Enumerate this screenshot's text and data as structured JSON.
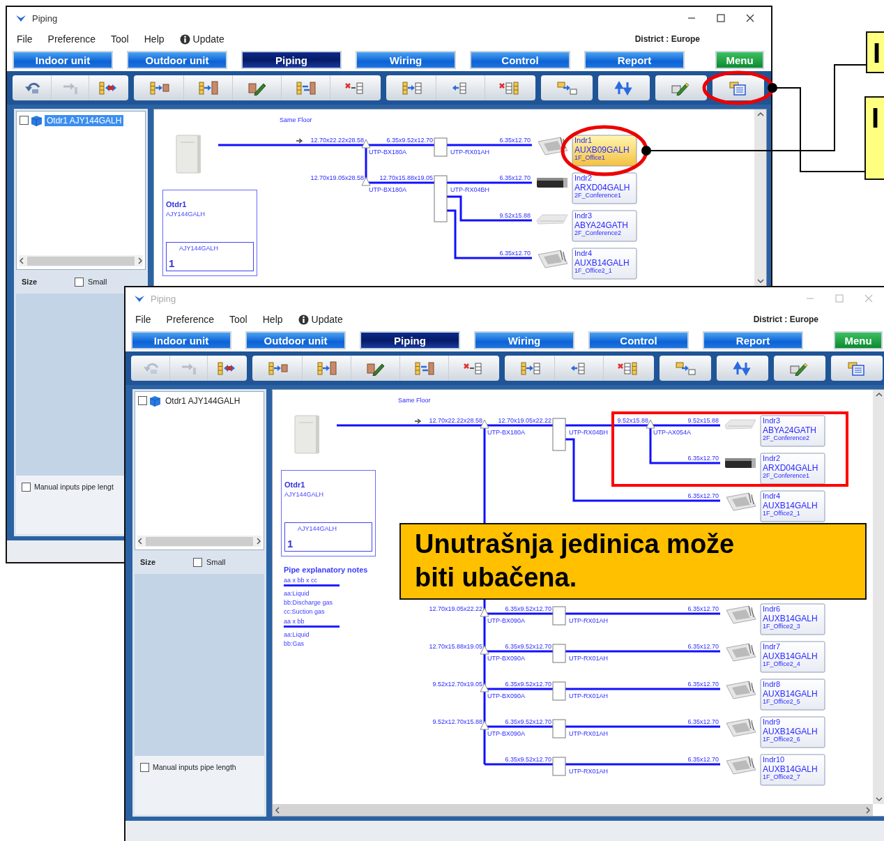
{
  "windows": [
    {
      "title": "Piping",
      "active": true,
      "menu": [
        "File",
        "Preference",
        "Tool",
        "Help"
      ],
      "update": "Update",
      "district": "District : Europe",
      "tabs": [
        {
          "label": "Indoor unit",
          "kind": "tab",
          "selected": false
        },
        {
          "label": "Outdoor unit",
          "kind": "tab",
          "selected": false
        },
        {
          "label": "Piping",
          "kind": "tab",
          "selected": true
        },
        {
          "label": "Wiring",
          "kind": "tab",
          "selected": false
        },
        {
          "label": "Control",
          "kind": "tab",
          "selected": false
        },
        {
          "label": "Report",
          "kind": "tab",
          "selected": false
        },
        {
          "label": "Menu",
          "kind": "menu",
          "selected": false
        }
      ],
      "toolbar": [
        {
          "buttons": [
            {
              "disabled": false,
              "circled": false
            },
            {
              "disabled": true,
              "circled": false
            },
            {
              "disabled": false,
              "circled": false
            }
          ]
        },
        {
          "buttons": [
            {
              "disabled": false,
              "circled": false
            },
            {
              "disabled": false,
              "circled": false
            },
            {
              "disabled": false,
              "circled": false
            },
            {
              "disabled": false,
              "circled": false
            },
            {
              "disabled": false,
              "circled": false
            }
          ]
        },
        {
          "buttons": [
            {
              "disabled": false,
              "circled": false
            },
            {
              "disabled": false,
              "circled": false
            },
            {
              "disabled": false,
              "circled": false
            }
          ]
        },
        {
          "buttons": [
            {
              "disabled": false,
              "circled": false
            }
          ]
        },
        {
          "buttons": [
            {
              "disabled": false,
              "circled": false
            }
          ]
        },
        {
          "buttons": [
            {
              "disabled": false,
              "circled": false
            }
          ]
        },
        {
          "buttons": [
            {
              "disabled": false,
              "circled": true
            }
          ]
        }
      ],
      "tree": [
        {
          "label": "Otdr1 AJY144GALH",
          "checked": false,
          "selected": true
        }
      ],
      "size_label": "Size",
      "small": {
        "label": "Small",
        "checked": false
      },
      "manual": {
        "label": "Manual inputs pipe lengt",
        "checked": false
      },
      "diagram": {
        "floor": "Same Floor",
        "outdoor": {
          "name": "Otdr1",
          "model": "AJY144GALH",
          "sub_model": "AJY144GALH",
          "count": "1"
        },
        "groups": [
          {
            "kind": "branch",
            "trunk": "12.70x22.22x28.58",
            "kit": "UTP-BX180A",
            "segment": "6.35x9.52x12.70",
            "header": "UTP-RX01AH",
            "outlets": [
              {
                "kind": "cassette",
                "pipe": "6.35x12.70",
                "name": "Indr1",
                "model": "AUXB09GALH",
                "room": "1F_Office1",
                "selected": true,
                "circled": true
              }
            ]
          },
          {
            "kind": "branch",
            "trunk": "12.70x19.05x28.58",
            "kit": "UTP-BX180A",
            "segment": "12.70x15.88x19.05",
            "header": "UTP-RX04BH",
            "outlets": [
              {
                "kind": "duct",
                "pipe": "6.35x12.70",
                "name": "Indr2",
                "model": "ARXD04GALH",
                "room": "2F_Conference1",
                "selected": false,
                "circled": false
              },
              {
                "kind": "ceiling",
                "pipe": "9.52x15.88",
                "name": "Indr3",
                "model": "ABYA24GATH",
                "room": "2F_Conference2",
                "selected": false,
                "circled": false
              },
              {
                "kind": "cassette",
                "pipe": "6.35x12.70",
                "name": "Indr4",
                "model": "AUXB14GALH",
                "room": "1F_Office2_1",
                "selected": false,
                "circled": false
              }
            ]
          }
        ]
      }
    },
    {
      "title": "Piping",
      "active": false,
      "menu": [
        "File",
        "Preference",
        "Tool",
        "Help"
      ],
      "update": "Update",
      "district": "District : Europe",
      "tabs": [
        {
          "label": "Indoor unit",
          "kind": "tab",
          "selected": false
        },
        {
          "label": "Outdoor unit",
          "kind": "tab",
          "selected": false
        },
        {
          "label": "Piping",
          "kind": "tab",
          "selected": true
        },
        {
          "label": "Wiring",
          "kind": "tab",
          "selected": false
        },
        {
          "label": "Control",
          "kind": "tab",
          "selected": false
        },
        {
          "label": "Report",
          "kind": "tab",
          "selected": false
        },
        {
          "label": "Menu",
          "kind": "menu",
          "selected": false
        }
      ],
      "toolbar": [
        {
          "buttons": [
            {
              "disabled": true,
              "circled": false
            },
            {
              "disabled": true,
              "circled": false
            },
            {
              "disabled": false,
              "circled": false
            }
          ]
        },
        {
          "buttons": [
            {
              "disabled": false,
              "circled": false
            },
            {
              "disabled": false,
              "circled": false
            },
            {
              "disabled": false,
              "circled": false
            },
            {
              "disabled": false,
              "circled": false
            },
            {
              "disabled": false,
              "circled": false
            }
          ]
        },
        {
          "buttons": [
            {
              "disabled": false,
              "circled": false
            },
            {
              "disabled": false,
              "circled": false
            },
            {
              "disabled": false,
              "circled": false
            }
          ]
        },
        {
          "buttons": [
            {
              "disabled": false,
              "circled": false
            }
          ]
        },
        {
          "buttons": [
            {
              "disabled": false,
              "circled": false
            }
          ]
        },
        {
          "buttons": [
            {
              "disabled": false,
              "circled": false
            }
          ]
        },
        {
          "buttons": [
            {
              "disabled": false,
              "circled": false
            }
          ]
        }
      ],
      "tree": [
        {
          "label": "Otdr1 AJY144GALH",
          "checked": false,
          "selected": false
        }
      ],
      "size_label": "Size",
      "small": {
        "label": "Small",
        "checked": false
      },
      "manual": {
        "label": "Manual inputs pipe length",
        "checked": false
      },
      "diagram": {
        "floor": "Same Floor",
        "outdoor": {
          "name": "Otdr1",
          "model": "AJY144GALH",
          "sub_model": "AJY144GALH",
          "count": "1"
        },
        "notes": {
          "title": "Pipe explanatory notes",
          "sections": [
            {
              "heading": "aa x bb x cc",
              "lines": [
                "aa:Liquid",
                "bb:Discharge gas",
                "cc:Suction gas"
              ]
            },
            {
              "heading": "aa x bb",
              "lines": [
                "aa:Liquid",
                "bb:Gas"
              ]
            }
          ]
        },
        "groups": [
          {
            "kind": "branch",
            "trunk": "12.70x22.22x28.58",
            "kit": "UTP-BX180A",
            "segment": "12.70x19.05x22.22",
            "header": "UTP-RX04BH",
            "outlets": [
              {
                "kind": "joint",
                "pipe": "9.52x15.88",
                "kit": "UTP-AX054A",
                "boxed": true,
                "units": [
                  {
                    "kind": "ceiling",
                    "pipe": "9.52x15.88",
                    "name": "Indr3",
                    "model": "ABYA24GATH",
                    "room": "2F_Conference2",
                    "selected": false,
                    "circled": false
                  },
                  {
                    "kind": "duct",
                    "pipe": "6.35x12.70",
                    "name": "Indr2",
                    "model": "ARXD04GALH",
                    "room": "2F_Conference1",
                    "selected": false,
                    "circled": false
                  }
                ]
              },
              {
                "kind": "cassette",
                "pipe": "6.35x12.70",
                "name": "Indr4",
                "model": "AUXB14GALH",
                "room": "1F_Office2_1",
                "selected": false,
                "circled": false
              }
            ]
          },
          {
            "kind": "callout",
            "text": "Unutrašnja jedinica može biti ubačena."
          },
          {
            "kind": "branch",
            "trunk": "12.70x19.05x22.22",
            "kit": "UTP-BX090A",
            "segment": "6.35x9.52x12.70",
            "header": "UTP-RX01AH",
            "outlets": [
              {
                "kind": "cassette",
                "pipe": "6.35x12.70",
                "name": "Indr6",
                "model": "AUXB14GALH",
                "room": "1F_Office2_3",
                "selected": false,
                "circled": false
              }
            ]
          },
          {
            "kind": "branch",
            "trunk": "12.70x15.88x19.05",
            "kit": "UTP-BX090A",
            "segment": "6.35x9.52x12.70",
            "header": "UTP-RX01AH",
            "outlets": [
              {
                "kind": "cassette",
                "pipe": "6.35x12.70",
                "name": "Indr7",
                "model": "AUXB14GALH",
                "room": "1F_Office2_4",
                "selected": false,
                "circled": false
              }
            ]
          },
          {
            "kind": "branch",
            "trunk": "9.52x12.70x19.05",
            "kit": "UTP-BX090A",
            "segment": "6.35x9.52x12.70",
            "header": "UTP-RX01AH",
            "outlets": [
              {
                "kind": "cassette",
                "pipe": "6.35x12.70",
                "name": "Indr8",
                "model": "AUXB14GALH",
                "room": "1F_Office2_5",
                "selected": false,
                "circled": false
              }
            ]
          },
          {
            "kind": "branch",
            "trunk": "9.52x12.70x15.88",
            "kit": "UTP-BX090A",
            "segment": "6.35x9.52x12.70",
            "header": "UTP-RX01AH",
            "outlets": [
              {
                "kind": "cassette",
                "pipe": "6.35x12.70",
                "name": "Indr9",
                "model": "AUXB14GALH",
                "room": "1F_Office2_6",
                "selected": false,
                "circled": false
              }
            ]
          },
          {
            "kind": "branch",
            "segment": "6.35x9.52x12.70",
            "header": "UTP-RX01AH",
            "outlets": [
              {
                "kind": "cassette",
                "pipe": "6.35x12.70",
                "name": "Indr10",
                "model": "AUXB14GALH",
                "room": "1F_Office2_7",
                "selected": false,
                "circled": false
              }
            ]
          }
        ]
      }
    }
  ],
  "callouts": [
    {
      "text": "I"
    },
    {
      "text": "I"
    }
  ]
}
